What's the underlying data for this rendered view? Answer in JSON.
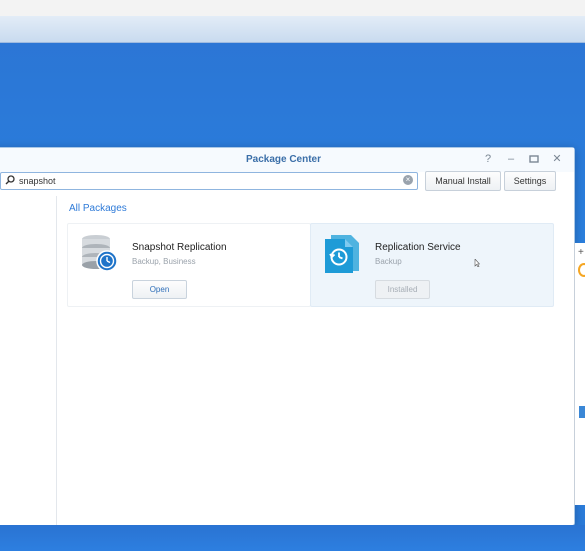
{
  "window": {
    "title": "Package Center",
    "controls": [
      "help",
      "minimize",
      "maximize",
      "close"
    ]
  },
  "toolbar": {
    "search_value": "snapshot",
    "manual_install_label": "Manual Install",
    "settings_label": "Settings"
  },
  "main": {
    "section_title": "All Packages",
    "packages": [
      {
        "name": "Snapshot Replication",
        "category": "Backup, Business",
        "action_label": "Open",
        "action_enabled": true,
        "icon": "database-clock-icon"
      },
      {
        "name": "Replication Service",
        "category": "Backup",
        "action_label": "Installed",
        "action_enabled": false,
        "icon": "document-restore-icon"
      }
    ]
  },
  "colors": {
    "accent": "#2f7bd8",
    "desktop": "#2a7ddc",
    "title_text": "#3a6ea8"
  }
}
